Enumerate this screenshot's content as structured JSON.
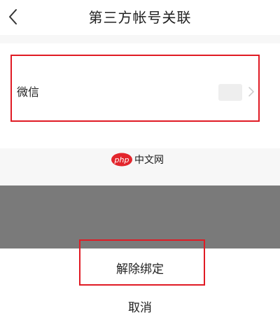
{
  "nav": {
    "title": "第三方帐号关联"
  },
  "accounts": {
    "items": [
      {
        "label": "微信"
      }
    ]
  },
  "watermark": {
    "text": "中文网"
  },
  "action_sheet": {
    "unbind_label": "解除绑定",
    "cancel_label": "取消"
  },
  "colors": {
    "highlight": "#e01b24",
    "mask": "#7a7a7a",
    "logo_red": "#e3262d"
  }
}
